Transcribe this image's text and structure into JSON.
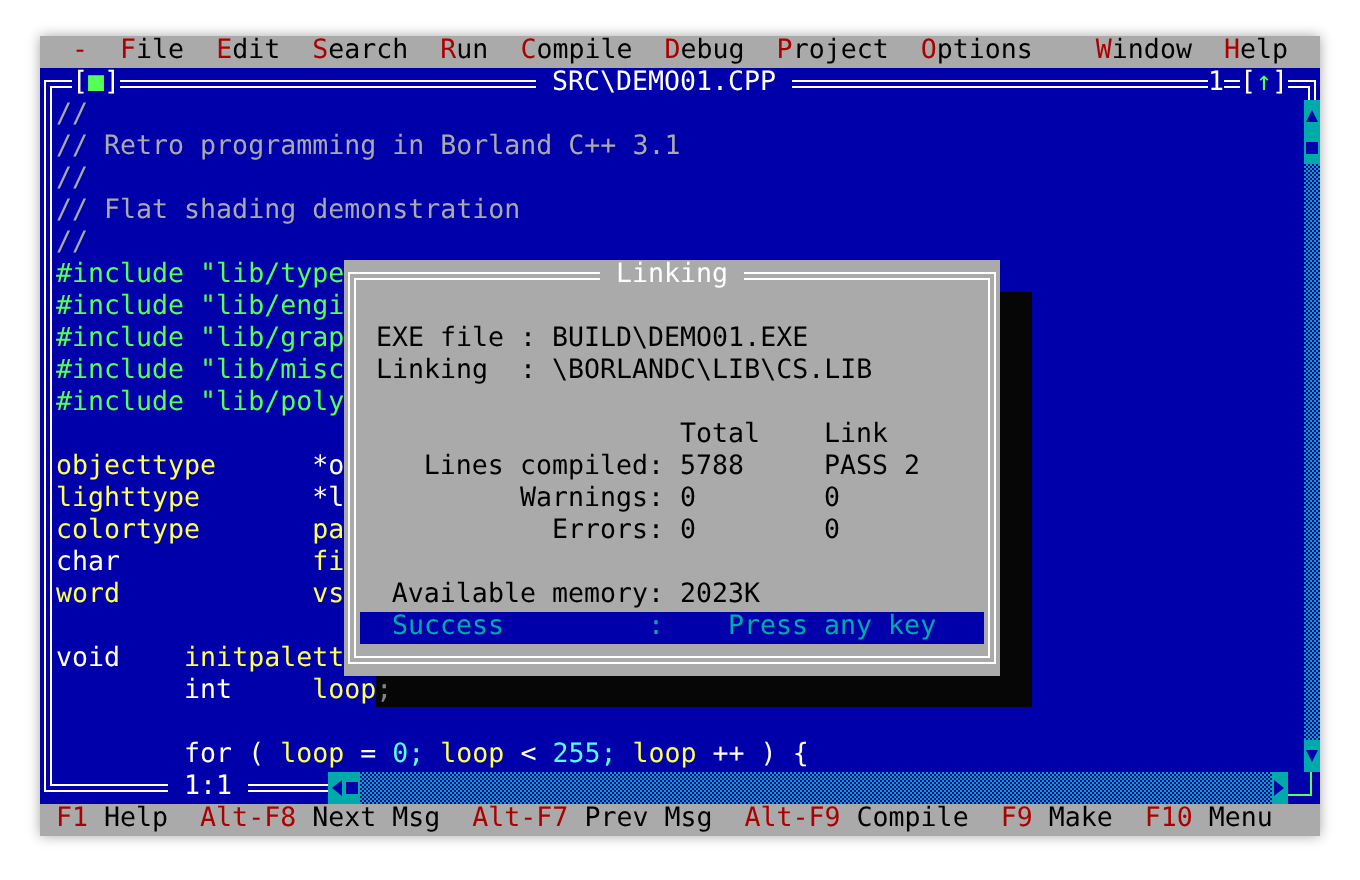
{
  "menu_bar": {
    "left_items": [
      "-",
      "File",
      "Edit",
      "Search",
      "Run",
      "Compile",
      "Debug",
      "Project",
      "Options"
    ],
    "right_items": [
      "Window",
      "Help"
    ]
  },
  "editor": {
    "close_button": "[■]",
    "title": "SRC\\DEMO01.CPP",
    "window_number": "1",
    "zoom_button": "[↑]",
    "cursor_position": "1:1",
    "lines": [
      {
        "kind": "code",
        "segments": [
          {
            "text": "//",
            "kind": "comment"
          }
        ]
      },
      {
        "kind": "code",
        "segments": [
          {
            "text": "// Retro programming in Borland C++ 3.1",
            "kind": "comment"
          }
        ]
      },
      {
        "kind": "code",
        "segments": [
          {
            "text": "//",
            "kind": "comment"
          }
        ]
      },
      {
        "kind": "code",
        "segments": [
          {
            "text": "// Flat shading demonstration",
            "kind": "comment"
          }
        ]
      },
      {
        "kind": "code",
        "segments": [
          {
            "text": "//",
            "kind": "comment"
          }
        ]
      },
      {
        "kind": "code",
        "segments": [
          {
            "text": "#include \"lib/type",
            "kind": "directive"
          }
        ]
      },
      {
        "kind": "code",
        "segments": [
          {
            "text": "#include \"lib/engi",
            "kind": "directive"
          }
        ]
      },
      {
        "kind": "code",
        "segments": [
          {
            "text": "#include \"lib/grap",
            "kind": "directive"
          }
        ]
      },
      {
        "kind": "code",
        "segments": [
          {
            "text": "#include \"lib/misc",
            "kind": "directive"
          }
        ]
      },
      {
        "kind": "code",
        "segments": [
          {
            "text": "#include \"lib/poly",
            "kind": "directive"
          }
        ]
      },
      {
        "kind": "blank"
      },
      {
        "kind": "code",
        "segments": [
          {
            "text": "objecttype",
            "kind": "identifier"
          },
          {
            "text": "      *o",
            "kind": "plain"
          }
        ]
      },
      {
        "kind": "code",
        "segments": [
          {
            "text": "lighttype",
            "kind": "identifier"
          },
          {
            "text": "       *l",
            "kind": "plain"
          }
        ]
      },
      {
        "kind": "code",
        "segments": [
          {
            "text": "colortype",
            "kind": "identifier"
          },
          {
            "text": "       pa",
            "kind": "identifier"
          }
        ]
      },
      {
        "kind": "code",
        "segments": [
          {
            "text": "char",
            "kind": "plain"
          },
          {
            "text": "            fi",
            "kind": "identifier"
          }
        ]
      },
      {
        "kind": "code",
        "segments": [
          {
            "text": "word",
            "kind": "identifier"
          },
          {
            "text": "            vs",
            "kind": "identifier"
          }
        ]
      },
      {
        "kind": "blank"
      },
      {
        "kind": "code",
        "segments": [
          {
            "text": "void    ",
            "kind": "plain"
          },
          {
            "text": "initpalett",
            "kind": "identifier"
          }
        ]
      },
      {
        "kind": "code",
        "segments": [
          {
            "text": "        int     ",
            "kind": "plain"
          },
          {
            "text": "loop",
            "kind": "identifier"
          },
          {
            "text": ";",
            "kind": "plain"
          }
        ]
      },
      {
        "kind": "blank"
      },
      {
        "kind": "code",
        "segments": [
          {
            "text": "        for ( ",
            "kind": "plain"
          },
          {
            "text": "loop",
            "kind": "identifier"
          },
          {
            "text": " = ",
            "kind": "plain"
          },
          {
            "text": "0;",
            "kind": "number"
          },
          {
            "text": " loop",
            "kind": "identifier"
          },
          {
            "text": " < ",
            "kind": "plain"
          },
          {
            "text": "255;",
            "kind": "number"
          },
          {
            "text": " loop",
            "kind": "identifier"
          },
          {
            "text": " ++ ) {",
            "kind": "plain"
          }
        ]
      }
    ]
  },
  "dialog": {
    "title": "Linking",
    "info": [
      {
        "label": "EXE file",
        "separator": ":",
        "value": "BUILD\\DEMO01.EXE"
      },
      {
        "label": "Linking",
        "separator": ":",
        "value": "\\BORLANDC\\LIB\\CS.LIB"
      }
    ],
    "columns": [
      "Total",
      "Link"
    ],
    "stats": [
      {
        "label": "Lines compiled:",
        "total": "5788",
        "link": "PASS 2"
      },
      {
        "label": "Warnings:",
        "total": "0",
        "link": "0"
      },
      {
        "label": "Errors:",
        "total": "0",
        "link": "0"
      }
    ],
    "memory": {
      "label": "Available memory:",
      "value": "2023K"
    },
    "status": {
      "text": "Success",
      "separator": ":",
      "message": "Press any key"
    }
  },
  "status_bar": [
    {
      "key": "F1",
      "label": "Help"
    },
    {
      "key": "Alt-F8",
      "label": "Next Msg"
    },
    {
      "key": "Alt-F7",
      "label": "Prev Msg"
    },
    {
      "key": "Alt-F9",
      "label": "Compile"
    },
    {
      "key": "F9",
      "label": "Make"
    },
    {
      "key": "F10",
      "label": "Menu"
    }
  ]
}
